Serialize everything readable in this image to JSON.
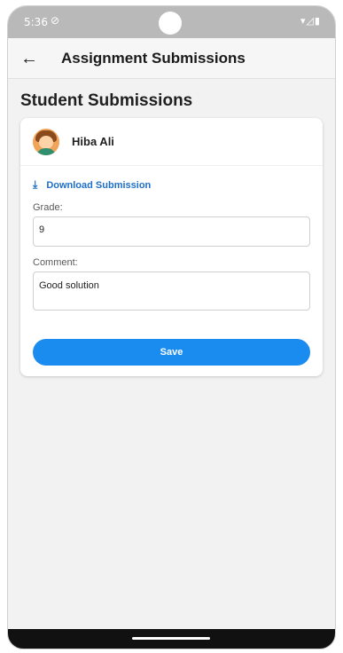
{
  "status_bar": {
    "time": "5:36",
    "dnd_icon": "do-not-disturb-icon",
    "right_icons": "▾◿▮"
  },
  "app_bar": {
    "back_icon": "arrow-left-icon",
    "title": "Assignment Submissions"
  },
  "page": {
    "section_title": "Student Submissions"
  },
  "submission": {
    "student_name": "Hiba Ali",
    "download_label": "Download Submission",
    "grade_label": "Grade:",
    "grade_value": "9",
    "comment_label": "Comment:",
    "comment_value": "Good solution",
    "save_label": "Save"
  },
  "colors": {
    "accent": "#1a8cf0",
    "link": "#1f6fc7"
  }
}
